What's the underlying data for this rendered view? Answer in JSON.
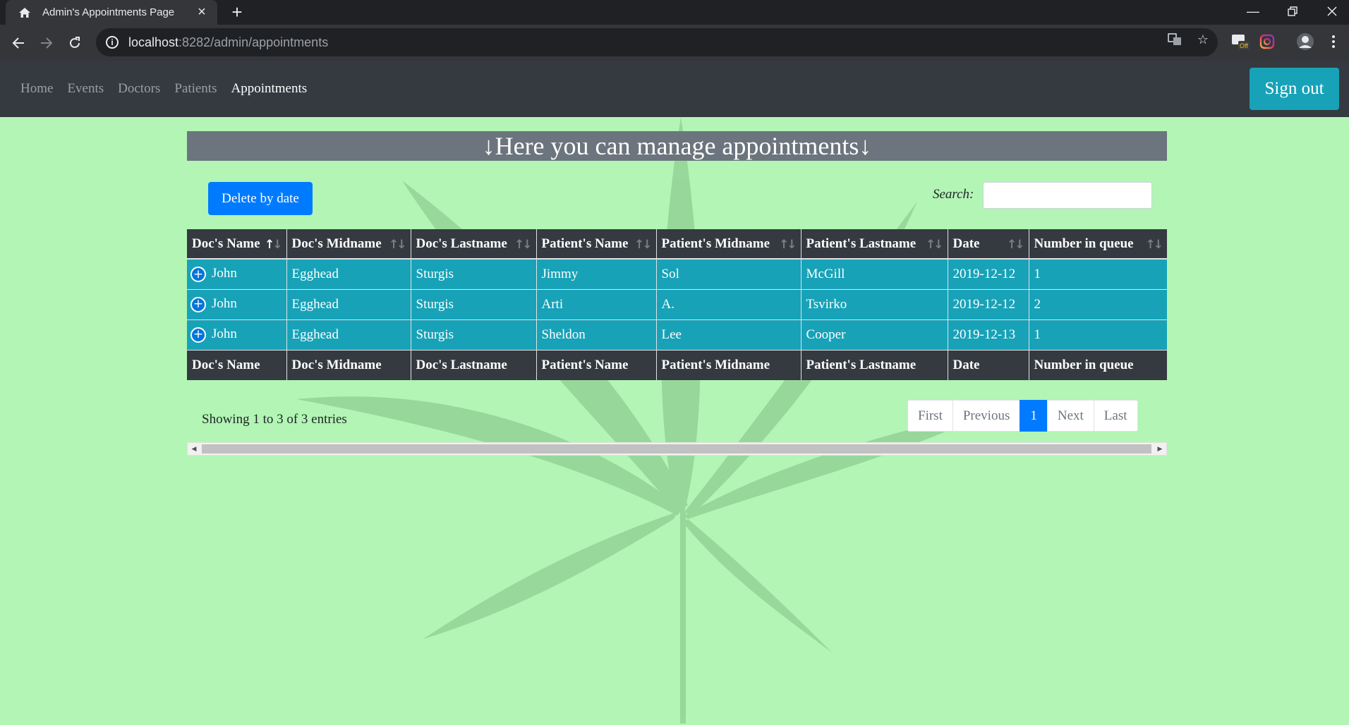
{
  "browser": {
    "tab_title": "Admin's Appointments Page",
    "tab_icon": "home-icon",
    "url_host": "localhost",
    "url_rest": ":8282/admin/appointments",
    "extension_badge": "Off"
  },
  "nav": {
    "links": [
      "Home",
      "Events",
      "Doctors",
      "Patients",
      "Appointments"
    ],
    "active": "Appointments",
    "signout_label": "Sign out"
  },
  "page": {
    "banner": "↓Here you can manage appointments↓",
    "delete_button": "Delete by date",
    "search_label": "Search:",
    "search_value": ""
  },
  "table": {
    "columns": [
      "Doc's Name",
      "Doc's Midname",
      "Doc's Lastname",
      "Patient's Name",
      "Patient's Midname",
      "Patient's Lastname",
      "Date",
      "Number in queue"
    ],
    "sorted_column": "Doc's Name",
    "sort_direction": "ascending",
    "rows": [
      [
        "John",
        "Egghead",
        "Sturgis",
        "Jimmy",
        "Sol",
        "McGill",
        "2019-12-12",
        "1"
      ],
      [
        "John",
        "Egghead",
        "Sturgis",
        "Arti",
        "A.",
        "Tsvirko",
        "2019-12-12",
        "2"
      ],
      [
        "John",
        "Egghead",
        "Sturgis",
        "Sheldon",
        "Lee",
        "Cooper",
        "2019-12-13",
        "1"
      ]
    ]
  },
  "footer": {
    "info": "Showing 1 to 3 of 3 entries",
    "pager": [
      "First",
      "Previous",
      "1",
      "Next",
      "Last"
    ],
    "current_page": "1"
  },
  "colors": {
    "page_background": "#b2f5b4",
    "navbar": "#343a40",
    "primary": "#007bff",
    "info": "#17a2b8",
    "banner": "#6c757d"
  }
}
